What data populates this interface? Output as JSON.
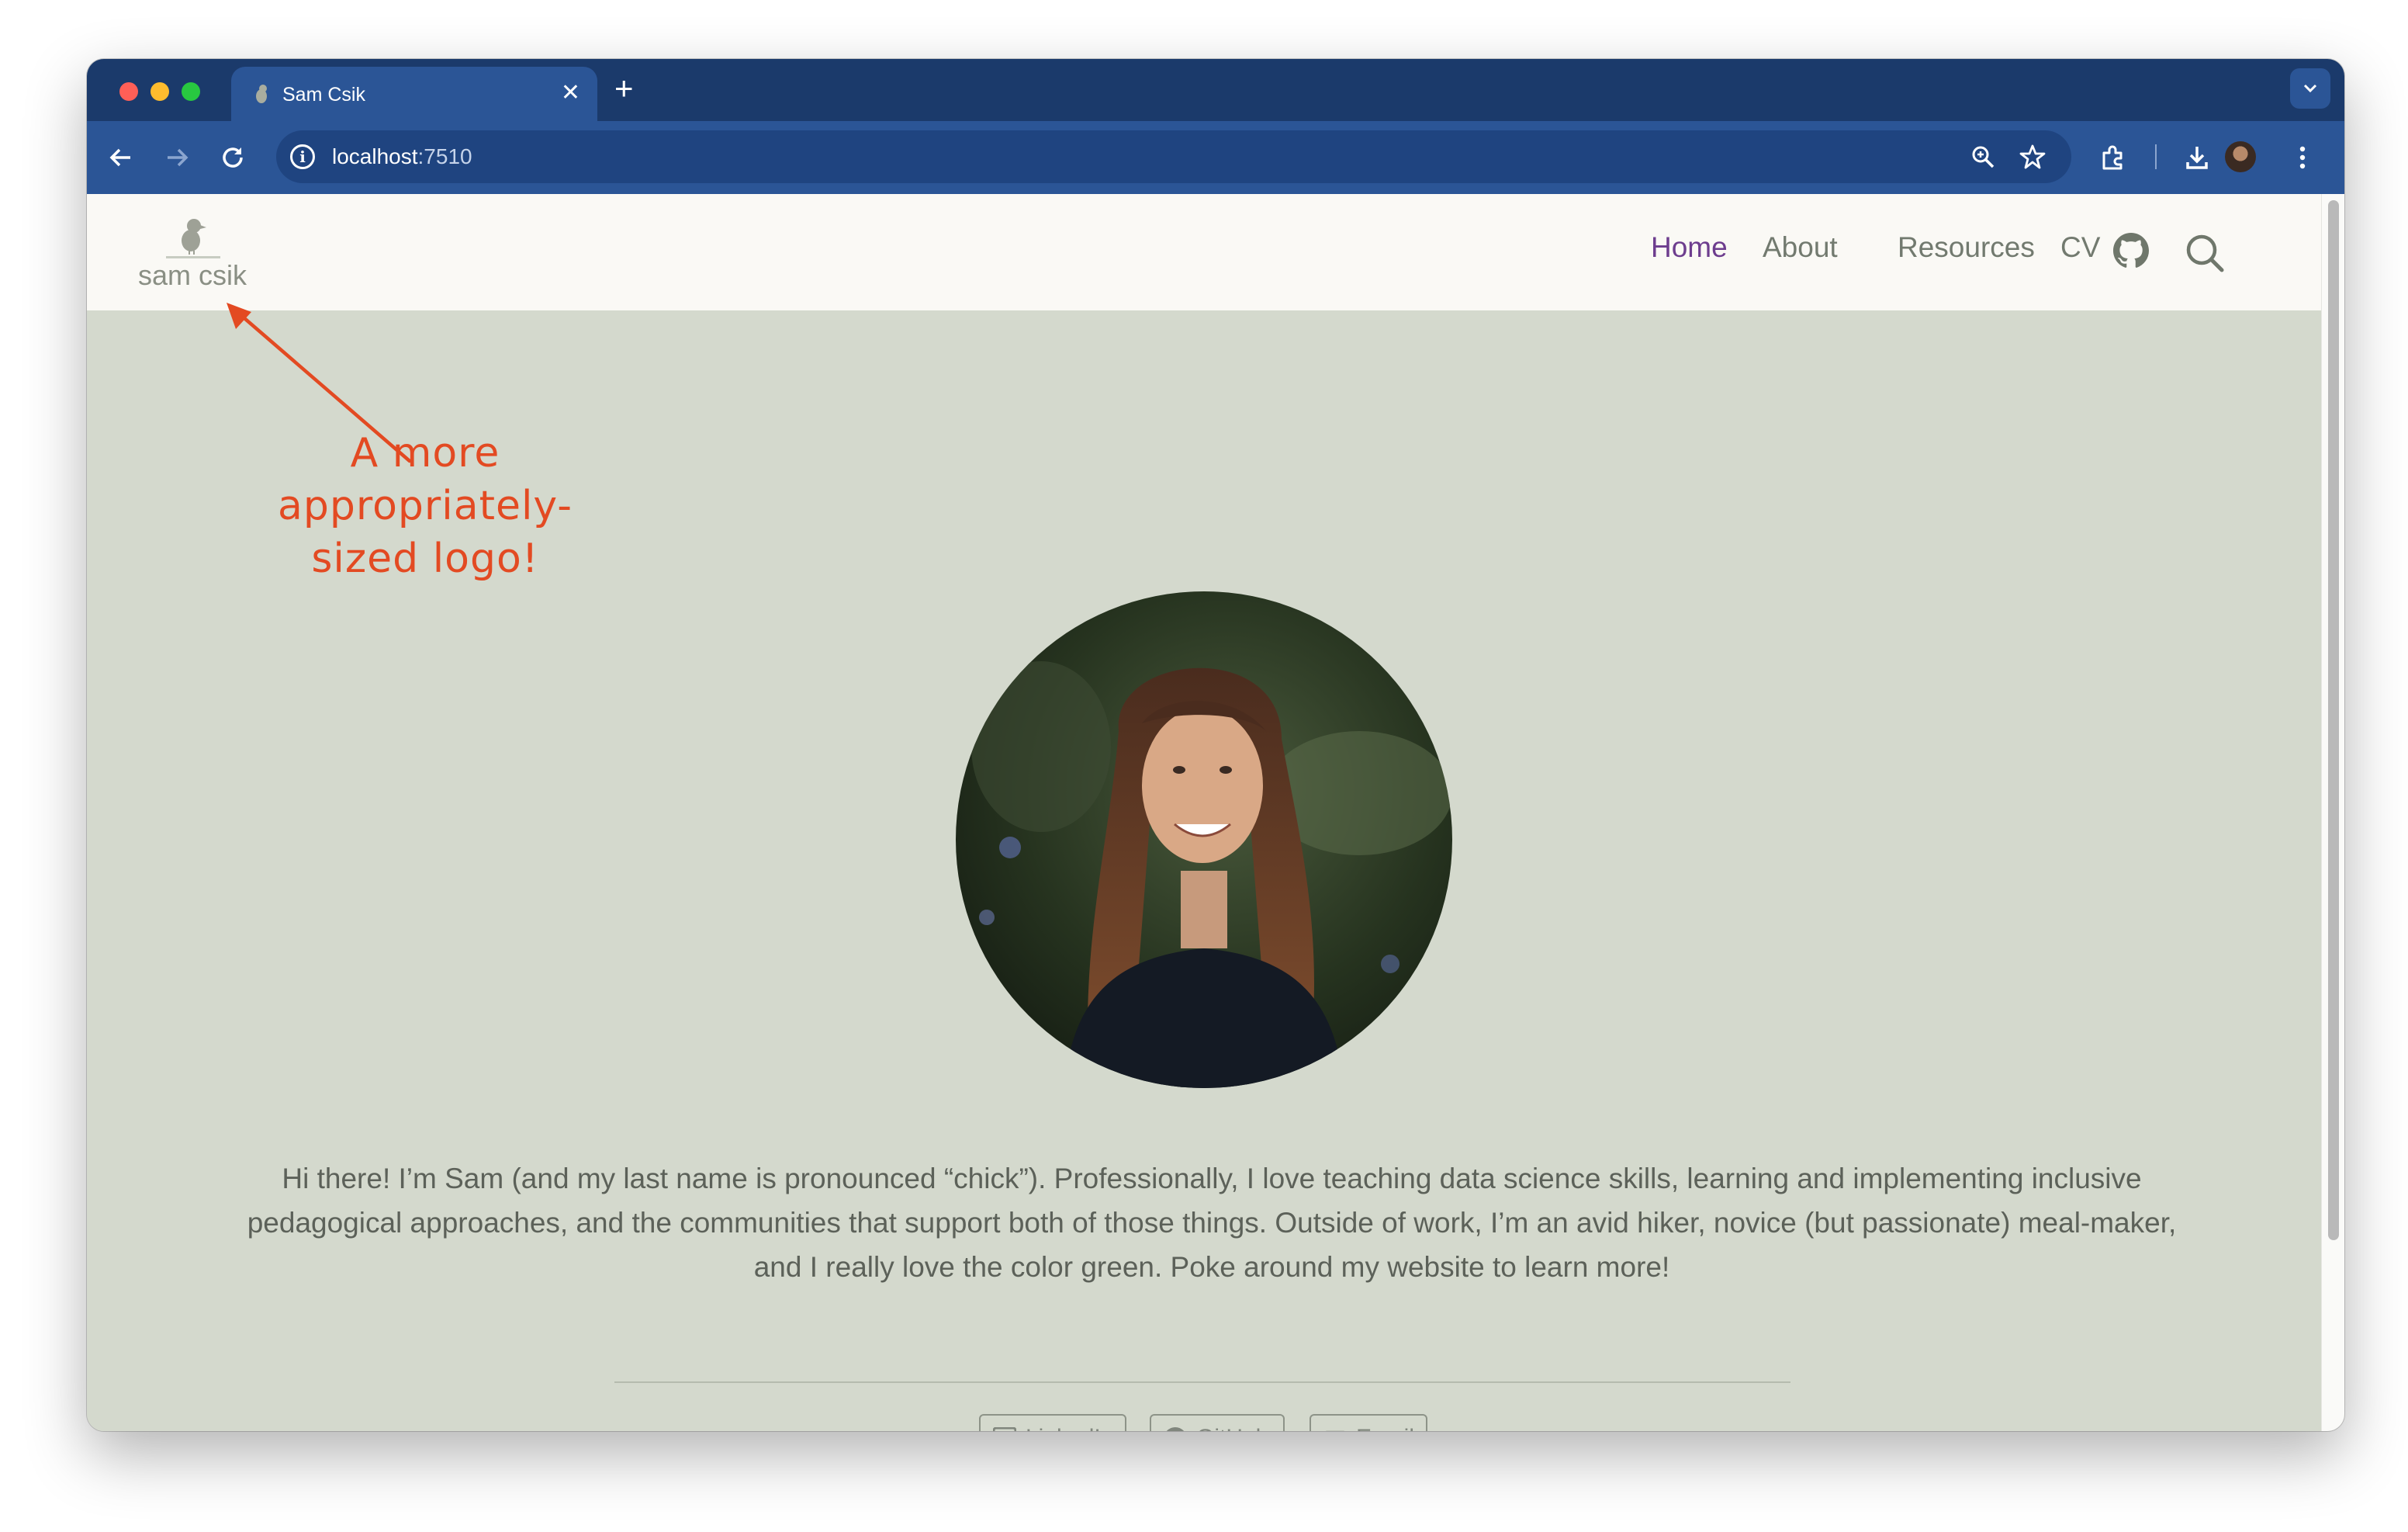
{
  "browser": {
    "tab_title": "Sam Csik",
    "url_host": "localhost",
    "url_port": ":7510"
  },
  "site": {
    "logo_text": "sam csik",
    "nav": [
      {
        "label": "Home",
        "active": true
      },
      {
        "label": "About",
        "active": false
      },
      {
        "label": "Resources",
        "active": false
      },
      {
        "label": "CV",
        "active": false
      }
    ]
  },
  "annotation": {
    "line1": "A more",
    "line2": "appropriately-",
    "line3": "sized logo!"
  },
  "bio": "Hi there! I’m Sam (and my last name is pronounced “chick”). Professionally, I love teaching data science skills, learning and implementing inclusive pedagogical approaches, and the communities that support both of those things. Outside of work, I’m an avid hiker, novice (but passionate) meal-maker, and I really love the color green. Poke around my website to learn more!",
  "social": [
    {
      "label": "LinkedIn"
    },
    {
      "label": "GitHub"
    },
    {
      "label": "Email"
    }
  ],
  "colors": {
    "page_bg": "#d4d9cd",
    "navbar_bg": "#faf9f5",
    "nav_active": "#6d3d8e",
    "annotation": "#e34a22",
    "browser_frame": "#1b3a6b"
  }
}
